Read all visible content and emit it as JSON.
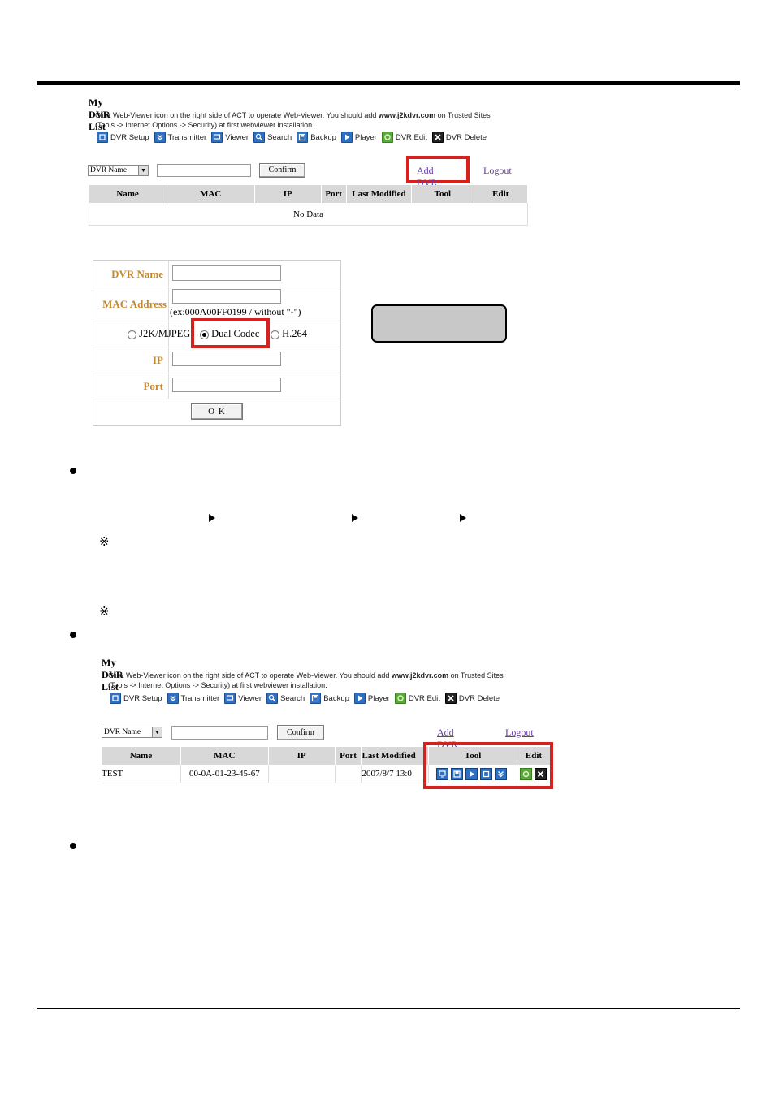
{
  "dvr_list_1": {
    "title": "My DVR List",
    "note_line1_a": "Click Web-Viewer icon on the right side of ACT to operate Web-Viewer. You should add ",
    "note_site": "www.j2kdvr.com",
    "note_line1_b": " on Trusted Sites",
    "note_line2": "(Tools -> Internet Options -> Security) at first webviewer installation.",
    "legend": [
      {
        "icon": "dvr-setup-icon",
        "label": "DVR Setup"
      },
      {
        "icon": "transmitter-icon",
        "label": "Transmitter"
      },
      {
        "icon": "viewer-icon",
        "label": "Viewer"
      },
      {
        "icon": "search-icon",
        "label": "Search"
      },
      {
        "icon": "backup-icon",
        "label": "Backup"
      },
      {
        "icon": "player-icon",
        "label": "Player"
      },
      {
        "icon": "dvr-edit-icon",
        "label": "DVR Edit"
      },
      {
        "icon": "dvr-delete-icon",
        "label": "DVR Delete"
      }
    ],
    "filter_select": "DVR Name",
    "confirm_label": "Confirm",
    "add_dvr_label": "Add DVR",
    "logout_label": "Logout",
    "columns": [
      "Name",
      "MAC",
      "IP",
      "Port",
      "Last Modified",
      "Tool",
      "Edit"
    ],
    "empty_text": "No Data"
  },
  "add_form": {
    "dvr_name_label": "DVR Name",
    "mac_label": "MAC Address",
    "mac_hint": "(ex:000A00FF0199 / without \"-\")",
    "codec_options": [
      "J2K/MJPEG",
      "Dual Codec",
      "H.264"
    ],
    "codec_selected": "Dual Codec",
    "ip_label": "IP",
    "port_label": "Port",
    "ok_label": "O K"
  },
  "bullets": {
    "ref_mark": "※"
  },
  "dvr_list_2": {
    "title": "My DVR List",
    "note_line1_a": "Click Web-Viewer icon on the right side of ACT to operate Web-Viewer. You should add ",
    "note_site": "www.j2kdvr.com",
    "note_line1_b": " on Trusted Sites",
    "note_line2": "(Tools -> Internet Options -> Security) at first webviewer installation.",
    "filter_select": "DVR Name",
    "confirm_label": "Confirm",
    "add_dvr_label": "Add DVR",
    "logout_label": "Logout",
    "columns": [
      "Name",
      "MAC",
      "IP",
      "Port",
      "Last Modified",
      "Tool",
      "Edit"
    ],
    "row": {
      "name": "TEST",
      "mac": "00-0A-01-23-45-67",
      "ip": "",
      "port": "",
      "last_modified": "2007/8/7 13:0"
    }
  },
  "colors": {
    "highlight_red": "#d6211f",
    "label_gold": "#c8882a",
    "link_purple": "#6a3aa8"
  }
}
